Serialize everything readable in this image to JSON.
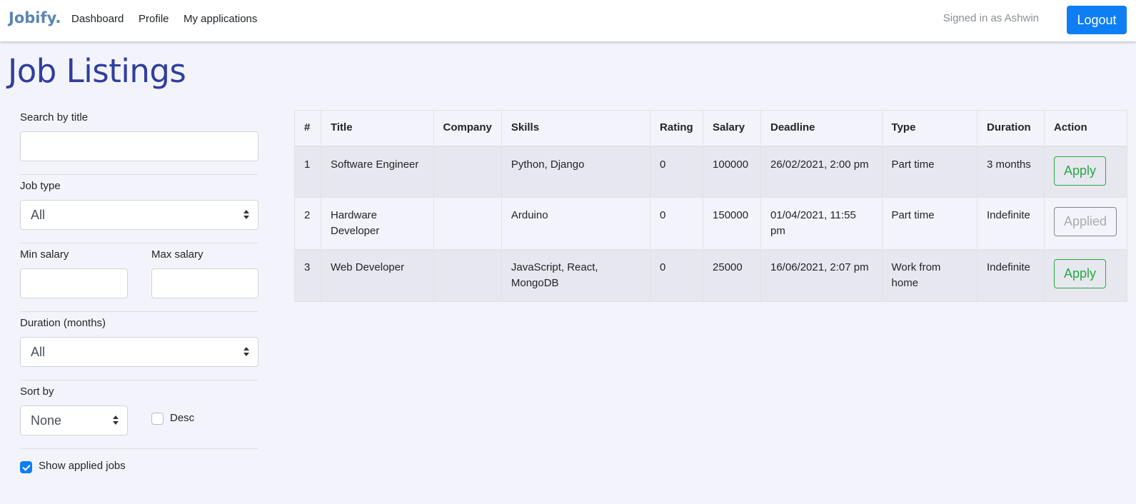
{
  "nav": {
    "brand": "Jobify.",
    "links": [
      "Dashboard",
      "Profile",
      "My applications"
    ],
    "signed_in": "Signed in as Ashwin",
    "logout": "Logout"
  },
  "page": {
    "title": "Job Listings"
  },
  "filters": {
    "search_label": "Search by title",
    "search_value": "",
    "job_type_label": "Job type",
    "job_type_value": "All",
    "min_salary_label": "Min salary",
    "max_salary_label": "Max salary",
    "duration_label": "Duration (months)",
    "duration_value": "All",
    "sort_label": "Sort by",
    "sort_value": "None",
    "desc_label": "Desc",
    "desc_checked": false,
    "show_applied_label": "Show applied jobs",
    "show_applied_checked": true
  },
  "table": {
    "headers": [
      "#",
      "Title",
      "Company",
      "Skills",
      "Rating",
      "Salary",
      "Deadline",
      "Type",
      "Duration",
      "Action"
    ],
    "rows": [
      {
        "num": "1",
        "title": "Software Engineer",
        "company": "",
        "skills": "Python, Django",
        "rating": "0",
        "salary": "100000",
        "deadline": "26/02/2021, 2:00 pm",
        "type": "Part time",
        "duration": "3 months",
        "action": "Apply"
      },
      {
        "num": "2",
        "title": "Hardware Developer",
        "company": "",
        "skills": "Arduino",
        "rating": "0",
        "salary": "150000",
        "deadline": "01/04/2021, 11:55 pm",
        "type": "Part time",
        "duration": "Indefinite",
        "action": "Applied"
      },
      {
        "num": "3",
        "title": "Web Developer",
        "company": "",
        "skills": "JavaScript, React, MongoDB",
        "rating": "0",
        "salary": "25000",
        "deadline": "16/06/2021, 2:07 pm",
        "type": "Work from home",
        "duration": "Indefinite",
        "action": "Apply"
      }
    ]
  },
  "colors": {
    "accent": "#0d7ef3",
    "brand": "#5a86b0",
    "title": "#2f3f9e",
    "apply": "#28a745",
    "background": "#f3f4fb"
  }
}
